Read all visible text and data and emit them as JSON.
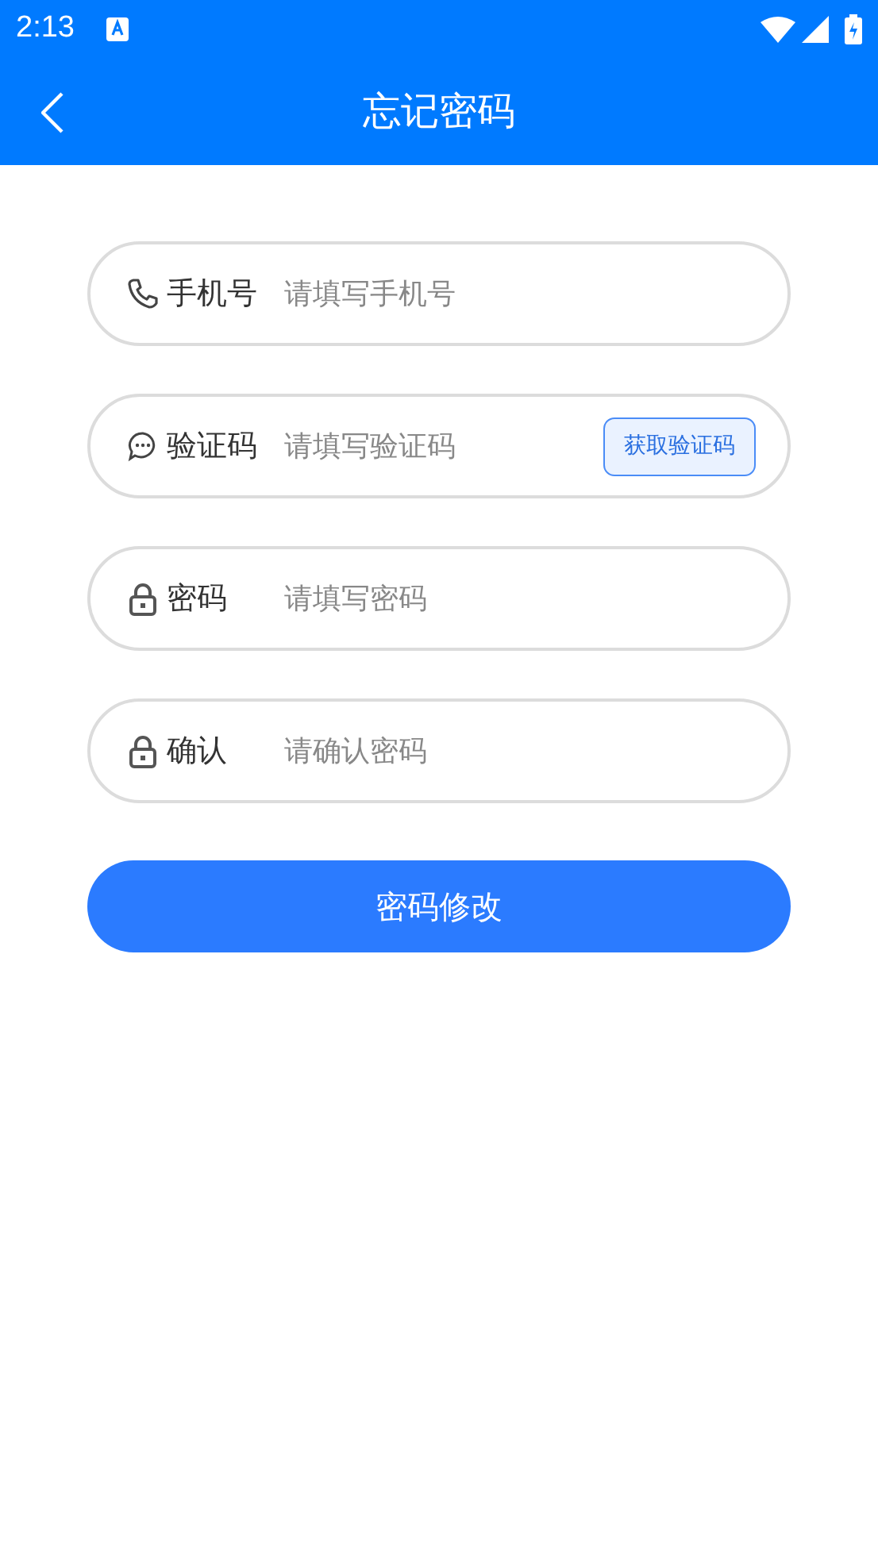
{
  "status_bar": {
    "time": "2:13"
  },
  "header": {
    "title": "忘记密码"
  },
  "fields": [
    {
      "kind": "phone",
      "label": "手机号",
      "placeholder": "请填写手机号"
    },
    {
      "kind": "code",
      "label": "验证码",
      "placeholder": "请填写验证码",
      "action": "获取验证码"
    },
    {
      "kind": "lock",
      "label": "密码",
      "placeholder": "请填写密码"
    },
    {
      "kind": "lock",
      "label": "确认",
      "placeholder": "请确认密码"
    }
  ],
  "submit": "密码修改"
}
